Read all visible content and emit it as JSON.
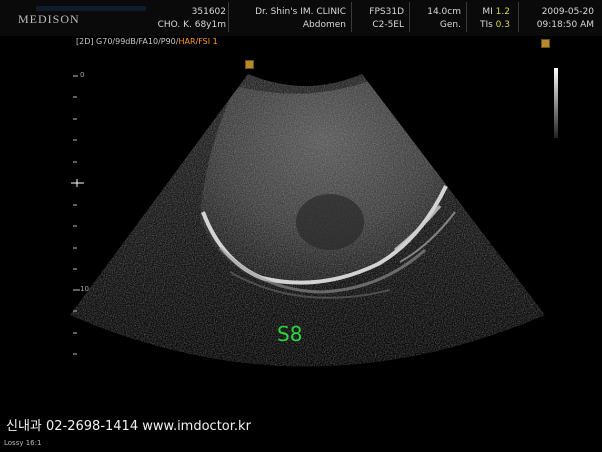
{
  "header": {
    "logo": "MEDISON",
    "id_number": "351602",
    "patient": "CHO. K. 68y1m",
    "clinic": "Dr. Shin's  IM. CLINIC",
    "exam": "Abdomen",
    "preset": "FPS31D",
    "probe": "C2-5EL",
    "depth": "14.0cm",
    "gen": "Gen.",
    "mi_label": "MI",
    "mi_value": "1.2",
    "tis_label": "TIs",
    "tis_value": "0.3",
    "date": "2009-05-20",
    "time": "09:18:50 AM"
  },
  "mode_line": {
    "white": "[2D] G70/99dB/FA10/P90/",
    "orange": "HAR/FSI 1"
  },
  "depth_scale": {
    "top": "0",
    "mid": "10"
  },
  "annotation": "S8",
  "footer": "신내과 02-2698-1414  www.imdoctor.kr",
  "lossy": "Lossy 16:1",
  "colors": {
    "annotation": "#2fd33f",
    "mode_accent": "#ff9a2a",
    "mi_tis": "#d9d94a"
  }
}
